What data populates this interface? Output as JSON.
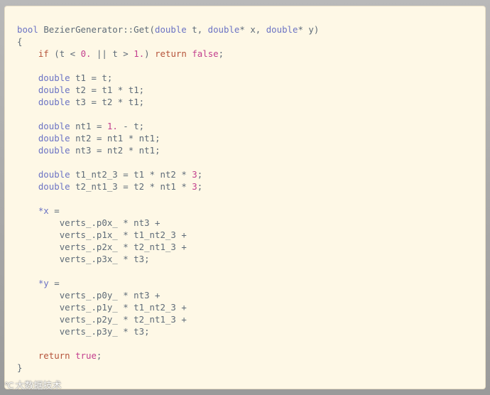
{
  "colors": {
    "background": "#fef8e6",
    "type": "#6b73c4",
    "keyword": "#b5533a",
    "number": "#c33e8e",
    "identifier": "#5e6b78"
  },
  "code_lines": [
    [
      [
        "type",
        "bool"
      ],
      [
        "ws",
        " "
      ],
      [
        "id",
        "BezierGenerator::Get"
      ],
      [
        "pn",
        "("
      ],
      [
        "type",
        "double"
      ],
      [
        "ws",
        " "
      ],
      [
        "id",
        "t"
      ],
      [
        "pn",
        ", "
      ],
      [
        "type",
        "double"
      ],
      [
        "op",
        "*"
      ],
      [
        "ws",
        " "
      ],
      [
        "id",
        "x"
      ],
      [
        "pn",
        ", "
      ],
      [
        "type",
        "double"
      ],
      [
        "op",
        "*"
      ],
      [
        "ws",
        " "
      ],
      [
        "id",
        "y"
      ],
      [
        "pn",
        ")"
      ]
    ],
    [
      [
        "pn",
        "{"
      ]
    ],
    [
      [
        "ws",
        "    "
      ],
      [
        "kw",
        "if"
      ],
      [
        "ws",
        " "
      ],
      [
        "pn",
        "("
      ],
      [
        "id",
        "t"
      ],
      [
        "ws",
        " "
      ],
      [
        "op",
        "<"
      ],
      [
        "ws",
        " "
      ],
      [
        "num",
        "0."
      ],
      [
        "ws",
        " "
      ],
      [
        "op",
        "||"
      ],
      [
        "ws",
        " "
      ],
      [
        "id",
        "t"
      ],
      [
        "ws",
        " "
      ],
      [
        "op",
        ">"
      ],
      [
        "ws",
        " "
      ],
      [
        "num",
        "1."
      ],
      [
        "pn",
        ")"
      ],
      [
        "ws",
        " "
      ],
      [
        "kw",
        "return"
      ],
      [
        "ws",
        " "
      ],
      [
        "bool",
        "false"
      ],
      [
        "pn",
        ";"
      ]
    ],
    [],
    [
      [
        "ws",
        "    "
      ],
      [
        "type",
        "double"
      ],
      [
        "ws",
        " "
      ],
      [
        "id",
        "t1"
      ],
      [
        "ws",
        " "
      ],
      [
        "op",
        "="
      ],
      [
        "ws",
        " "
      ],
      [
        "id",
        "t"
      ],
      [
        "pn",
        ";"
      ]
    ],
    [
      [
        "ws",
        "    "
      ],
      [
        "type",
        "double"
      ],
      [
        "ws",
        " "
      ],
      [
        "id",
        "t2"
      ],
      [
        "ws",
        " "
      ],
      [
        "op",
        "="
      ],
      [
        "ws",
        " "
      ],
      [
        "id",
        "t1"
      ],
      [
        "ws",
        " "
      ],
      [
        "op",
        "*"
      ],
      [
        "ws",
        " "
      ],
      [
        "id",
        "t1"
      ],
      [
        "pn",
        ";"
      ]
    ],
    [
      [
        "ws",
        "    "
      ],
      [
        "type",
        "double"
      ],
      [
        "ws",
        " "
      ],
      [
        "id",
        "t3"
      ],
      [
        "ws",
        " "
      ],
      [
        "op",
        "="
      ],
      [
        "ws",
        " "
      ],
      [
        "id",
        "t2"
      ],
      [
        "ws",
        " "
      ],
      [
        "op",
        "*"
      ],
      [
        "ws",
        " "
      ],
      [
        "id",
        "t1"
      ],
      [
        "pn",
        ";"
      ]
    ],
    [],
    [
      [
        "ws",
        "    "
      ],
      [
        "type",
        "double"
      ],
      [
        "ws",
        " "
      ],
      [
        "id",
        "nt1"
      ],
      [
        "ws",
        " "
      ],
      [
        "op",
        "="
      ],
      [
        "ws",
        " "
      ],
      [
        "num",
        "1."
      ],
      [
        "ws",
        " "
      ],
      [
        "op",
        "-"
      ],
      [
        "ws",
        " "
      ],
      [
        "id",
        "t"
      ],
      [
        "pn",
        ";"
      ]
    ],
    [
      [
        "ws",
        "    "
      ],
      [
        "type",
        "double"
      ],
      [
        "ws",
        " "
      ],
      [
        "id",
        "nt2"
      ],
      [
        "ws",
        " "
      ],
      [
        "op",
        "="
      ],
      [
        "ws",
        " "
      ],
      [
        "id",
        "nt1"
      ],
      [
        "ws",
        " "
      ],
      [
        "op",
        "*"
      ],
      [
        "ws",
        " "
      ],
      [
        "id",
        "nt1"
      ],
      [
        "pn",
        ";"
      ]
    ],
    [
      [
        "ws",
        "    "
      ],
      [
        "type",
        "double"
      ],
      [
        "ws",
        " "
      ],
      [
        "id",
        "nt3"
      ],
      [
        "ws",
        " "
      ],
      [
        "op",
        "="
      ],
      [
        "ws",
        " "
      ],
      [
        "id",
        "nt2"
      ],
      [
        "ws",
        " "
      ],
      [
        "op",
        "*"
      ],
      [
        "ws",
        " "
      ],
      [
        "id",
        "nt1"
      ],
      [
        "pn",
        ";"
      ]
    ],
    [],
    [
      [
        "ws",
        "    "
      ],
      [
        "type",
        "double"
      ],
      [
        "ws",
        " "
      ],
      [
        "id",
        "t1_nt2_3"
      ],
      [
        "ws",
        " "
      ],
      [
        "op",
        "="
      ],
      [
        "ws",
        " "
      ],
      [
        "id",
        "t1"
      ],
      [
        "ws",
        " "
      ],
      [
        "op",
        "*"
      ],
      [
        "ws",
        " "
      ],
      [
        "id",
        "nt2"
      ],
      [
        "ws",
        " "
      ],
      [
        "op",
        "*"
      ],
      [
        "ws",
        " "
      ],
      [
        "num",
        "3"
      ],
      [
        "pn",
        ";"
      ]
    ],
    [
      [
        "ws",
        "    "
      ],
      [
        "type",
        "double"
      ],
      [
        "ws",
        " "
      ],
      [
        "id",
        "t2_nt1_3"
      ],
      [
        "ws",
        " "
      ],
      [
        "op",
        "="
      ],
      [
        "ws",
        " "
      ],
      [
        "id",
        "t2"
      ],
      [
        "ws",
        " "
      ],
      [
        "op",
        "*"
      ],
      [
        "ws",
        " "
      ],
      [
        "id",
        "nt1"
      ],
      [
        "ws",
        " "
      ],
      [
        "op",
        "*"
      ],
      [
        "ws",
        " "
      ],
      [
        "num",
        "3"
      ],
      [
        "pn",
        ";"
      ]
    ],
    [],
    [
      [
        "ws",
        "    "
      ],
      [
        "type",
        "*x"
      ],
      [
        "ws",
        " "
      ],
      [
        "op",
        "="
      ]
    ],
    [
      [
        "ws",
        "        "
      ],
      [
        "id",
        "verts_.p0x_"
      ],
      [
        "ws",
        " "
      ],
      [
        "op",
        "*"
      ],
      [
        "ws",
        " "
      ],
      [
        "id",
        "nt3"
      ],
      [
        "ws",
        " "
      ],
      [
        "op",
        "+"
      ]
    ],
    [
      [
        "ws",
        "        "
      ],
      [
        "id",
        "verts_.p1x_"
      ],
      [
        "ws",
        " "
      ],
      [
        "op",
        "*"
      ],
      [
        "ws",
        " "
      ],
      [
        "id",
        "t1_nt2_3"
      ],
      [
        "ws",
        " "
      ],
      [
        "op",
        "+"
      ]
    ],
    [
      [
        "ws",
        "        "
      ],
      [
        "id",
        "verts_.p2x_"
      ],
      [
        "ws",
        " "
      ],
      [
        "op",
        "*"
      ],
      [
        "ws",
        " "
      ],
      [
        "id",
        "t2_nt1_3"
      ],
      [
        "ws",
        " "
      ],
      [
        "op",
        "+"
      ]
    ],
    [
      [
        "ws",
        "        "
      ],
      [
        "id",
        "verts_.p3x_"
      ],
      [
        "ws",
        " "
      ],
      [
        "op",
        "*"
      ],
      [
        "ws",
        " "
      ],
      [
        "id",
        "t3"
      ],
      [
        "pn",
        ";"
      ]
    ],
    [],
    [
      [
        "ws",
        "    "
      ],
      [
        "type",
        "*y"
      ],
      [
        "ws",
        " "
      ],
      [
        "op",
        "="
      ]
    ],
    [
      [
        "ws",
        "        "
      ],
      [
        "id",
        "verts_.p0y_"
      ],
      [
        "ws",
        " "
      ],
      [
        "op",
        "*"
      ],
      [
        "ws",
        " "
      ],
      [
        "id",
        "nt3"
      ],
      [
        "ws",
        " "
      ],
      [
        "op",
        "+"
      ]
    ],
    [
      [
        "ws",
        "        "
      ],
      [
        "id",
        "verts_.p1y_"
      ],
      [
        "ws",
        " "
      ],
      [
        "op",
        "*"
      ],
      [
        "ws",
        " "
      ],
      [
        "id",
        "t1_nt2_3"
      ],
      [
        "ws",
        " "
      ],
      [
        "op",
        "+"
      ]
    ],
    [
      [
        "ws",
        "        "
      ],
      [
        "id",
        "verts_.p2y_"
      ],
      [
        "ws",
        " "
      ],
      [
        "op",
        "*"
      ],
      [
        "ws",
        " "
      ],
      [
        "id",
        "t2_nt1_3"
      ],
      [
        "ws",
        " "
      ],
      [
        "op",
        "+"
      ]
    ],
    [
      [
        "ws",
        "        "
      ],
      [
        "id",
        "verts_.p3y_"
      ],
      [
        "ws",
        " "
      ],
      [
        "op",
        "*"
      ],
      [
        "ws",
        " "
      ],
      [
        "id",
        "t3"
      ],
      [
        "pn",
        ";"
      ]
    ],
    [],
    [
      [
        "ws",
        "    "
      ],
      [
        "kw",
        "return"
      ],
      [
        "ws",
        " "
      ],
      [
        "bool",
        "true"
      ],
      [
        "pn",
        ";"
      ]
    ],
    [
      [
        "pn",
        "}"
      ]
    ]
  ],
  "watermark": {
    "mark": "℃",
    "text": "大数据技术"
  }
}
